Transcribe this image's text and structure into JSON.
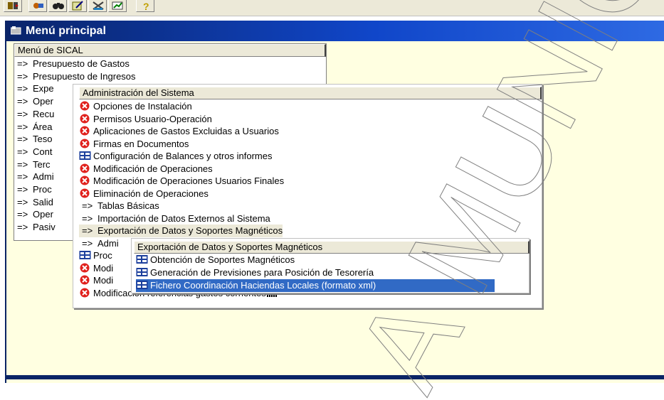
{
  "toolbar": {
    "buttons": [
      {
        "icon": "exit-door-icon"
      },
      {
        "icon": "tools-icon"
      },
      {
        "icon": "binoculars-icon"
      },
      {
        "icon": "edit-pen-icon"
      },
      {
        "icon": "cross-tools-icon"
      },
      {
        "icon": "chart-icon"
      },
      {
        "icon": "help-question-icon"
      }
    ]
  },
  "window": {
    "title": "Menú principal"
  },
  "main_menu": {
    "header": "Menú de SICAL",
    "items": [
      {
        "prefix": "=>",
        "label": "Presupuesto de Gastos"
      },
      {
        "prefix": "=>",
        "label": "Presupuesto de Ingresos"
      },
      {
        "prefix": "=>",
        "label": "Expe"
      },
      {
        "prefix": "=>",
        "label": "Oper"
      },
      {
        "prefix": "=>",
        "label": "Recu"
      },
      {
        "prefix": "=>",
        "label": "Área"
      },
      {
        "prefix": "=>",
        "label": "Teso"
      },
      {
        "prefix": "=>",
        "label": "Cont"
      },
      {
        "prefix": "=>",
        "label": "Terc"
      },
      {
        "prefix": "=>",
        "label": "Admi"
      },
      {
        "prefix": "=>",
        "label": "Proc"
      },
      {
        "prefix": "=>",
        "label": "Salid"
      },
      {
        "prefix": "=>",
        "label": "Oper"
      },
      {
        "prefix": "=>",
        "label": "Pasiv"
      }
    ]
  },
  "admin_menu": {
    "header": "Administración del Sistema",
    "items": [
      {
        "icon": "red-x-icon",
        "label": "Opciones de Instalación"
      },
      {
        "icon": "red-x-icon",
        "label": "Permisos Usuario-Operación"
      },
      {
        "icon": "red-x-icon",
        "label": "Aplicaciones de Gastos Excluidas a Usuarios"
      },
      {
        "icon": "red-x-icon",
        "label": "Firmas en Documentos"
      },
      {
        "icon": "form-icon",
        "label": "Configuración de Balances y otros informes"
      },
      {
        "icon": "red-x-icon",
        "label": "Modificación de Operaciones"
      },
      {
        "icon": "red-x-icon",
        "label": "Modificación de Operaciones Usuarios Finales"
      },
      {
        "icon": "red-x-icon",
        "label": "Eliminación de Operaciones"
      },
      {
        "icon": "arrow",
        "prefix": "=>",
        "label": "Tablas Básicas"
      },
      {
        "icon": "arrow",
        "prefix": "=>",
        "label": "Importación de Datos Externos al Sistema"
      },
      {
        "icon": "arrow",
        "prefix": "=>",
        "label": "Exportación de Datos y Soportes Magnéticos"
      },
      {
        "icon": "arrow",
        "prefix": "=>",
        "label": "Admi"
      },
      {
        "icon": "form-icon",
        "label": "Proc"
      },
      {
        "icon": "red-x-icon",
        "label": "Modi"
      },
      {
        "icon": "red-x-icon",
        "label": "Modi"
      },
      {
        "icon": "red-x-icon",
        "label": "Modificacion referencias gastos corrientes"
      }
    ]
  },
  "export_menu": {
    "header": "Exportación de Datos y Soportes Magnéticos",
    "items": [
      {
        "icon": "form-icon",
        "label": "Obtención  de Soportes Magnéticos"
      },
      {
        "icon": "form-icon",
        "label": "Generación de Previsiones para Posición de Tesorería"
      },
      {
        "icon": "form-icon",
        "label": "Fichero Coordinación Haciendas Locales (formato xml)"
      }
    ]
  },
  "watermark": {
    "text": "A MUNICI"
  },
  "colors": {
    "title_dark": "#0a246a",
    "title_light": "#2f6be4",
    "selection": "#316ac5",
    "window_bg": "#ffffe1",
    "menu_header": "#ece9d8"
  }
}
